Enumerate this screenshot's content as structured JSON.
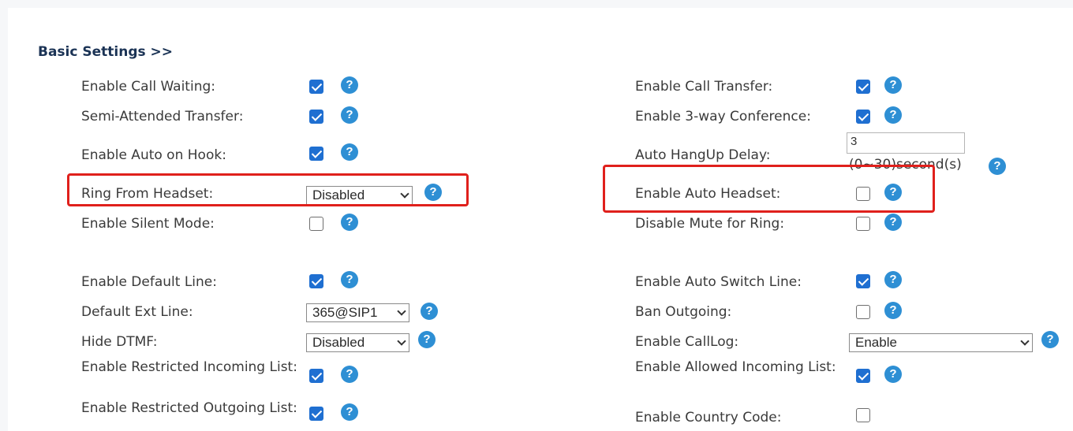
{
  "section": {
    "title": "Basic Settings >>"
  },
  "left": {
    "call_waiting": {
      "label": "Enable Call Waiting:",
      "checked": true
    },
    "semi_attended": {
      "label": "Semi-Attended Transfer:",
      "checked": true
    },
    "auto_on_hook": {
      "label": "Enable Auto on Hook:",
      "checked": true
    },
    "ring_from_headset": {
      "label": "Ring From Headset:",
      "value": "Disabled"
    },
    "silent_mode": {
      "label": "Enable Silent Mode:",
      "checked": false
    },
    "default_line": {
      "label": "Enable Default Line:",
      "checked": true
    },
    "default_ext_line": {
      "label": "Default Ext Line:",
      "value": "365@SIP1"
    },
    "hide_dtmf": {
      "label": "Hide DTMF:",
      "value": "Disabled"
    },
    "restricted_incoming": {
      "label": "Enable Restricted Incoming List:",
      "checked": true
    },
    "restricted_outgoing": {
      "label": "Enable Restricted Outgoing List:",
      "checked": true
    }
  },
  "right": {
    "call_transfer": {
      "label": "Enable Call Transfer:",
      "checked": true
    },
    "three_way": {
      "label": "Enable 3-way Conference:",
      "checked": true
    },
    "auto_hangup_delay": {
      "label": "Auto HangUp Delay:",
      "value": "3",
      "hint": "(0~30)second(s)"
    },
    "auto_headset": {
      "label": "Enable Auto Headset:",
      "checked": false
    },
    "disable_mute_ring": {
      "label": "Disable Mute for Ring:",
      "checked": false
    },
    "auto_switch_line": {
      "label": "Enable Auto Switch Line:",
      "checked": true
    },
    "ban_outgoing": {
      "label": "Ban Outgoing:",
      "checked": false
    },
    "calllog": {
      "label": "Enable CallLog:",
      "value": "Enable"
    },
    "allowed_incoming": {
      "label": "Enable Allowed Incoming List:",
      "checked": true
    },
    "country_code": {
      "label": "Enable Country Code:",
      "checked": false
    }
  },
  "help_glyph": "?",
  "icons": {
    "help": "help-icon",
    "dropdown": "chevron-down-icon"
  },
  "colors": {
    "checkbox_on": "#1f6fd1",
    "help": "#2e8fd4",
    "highlight": "#e0201c",
    "section_title": "#1b3355"
  }
}
